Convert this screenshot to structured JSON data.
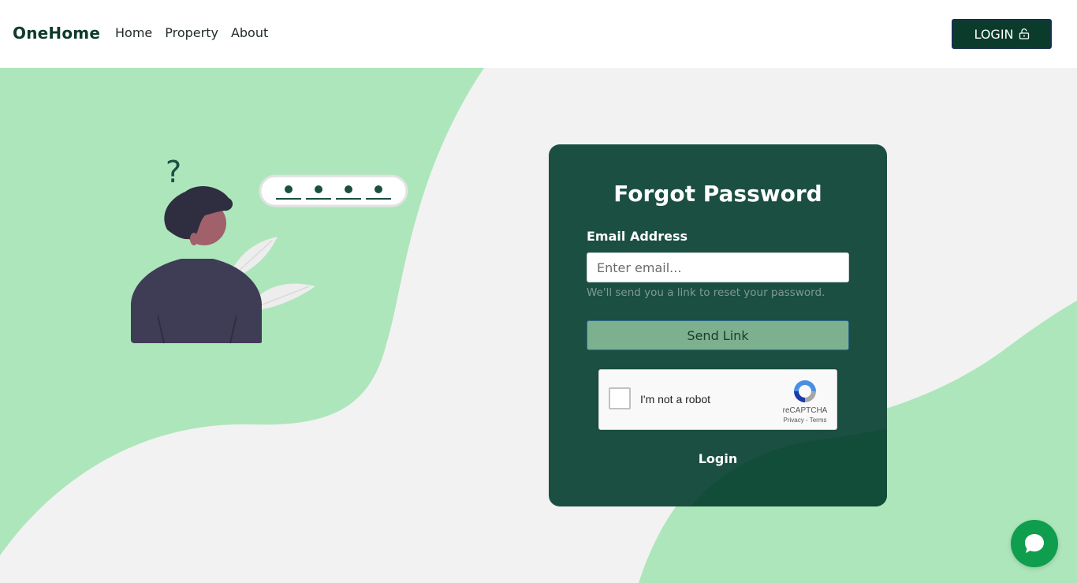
{
  "nav": {
    "brand": "OneHome",
    "links": [
      "Home",
      "Property",
      "About"
    ],
    "login_label": "LOGIN"
  },
  "form": {
    "title": "Forgot Password",
    "email_label": "Email Address",
    "email_placeholder": "Enter email...",
    "email_value": "",
    "help_text": "We'll send you a link to reset your password.",
    "submit_label": "Send Link",
    "login_link": "Login"
  },
  "recaptcha": {
    "label": "I'm not a robot",
    "brand": "reCAPTCHA",
    "links": "Privacy - Terms",
    "checked": false
  },
  "illustration": {
    "question_mark": "?"
  },
  "colors": {
    "accent_dark": "#0b3b2a",
    "card": "#1b4f41",
    "mint": "#ade6bb",
    "button": "#7db08f",
    "chat": "#0e9e4e"
  },
  "icons": {
    "login": "lock-open-icon",
    "chat": "chat-bubble-icon",
    "recaptcha": "recaptcha-logo-icon"
  }
}
